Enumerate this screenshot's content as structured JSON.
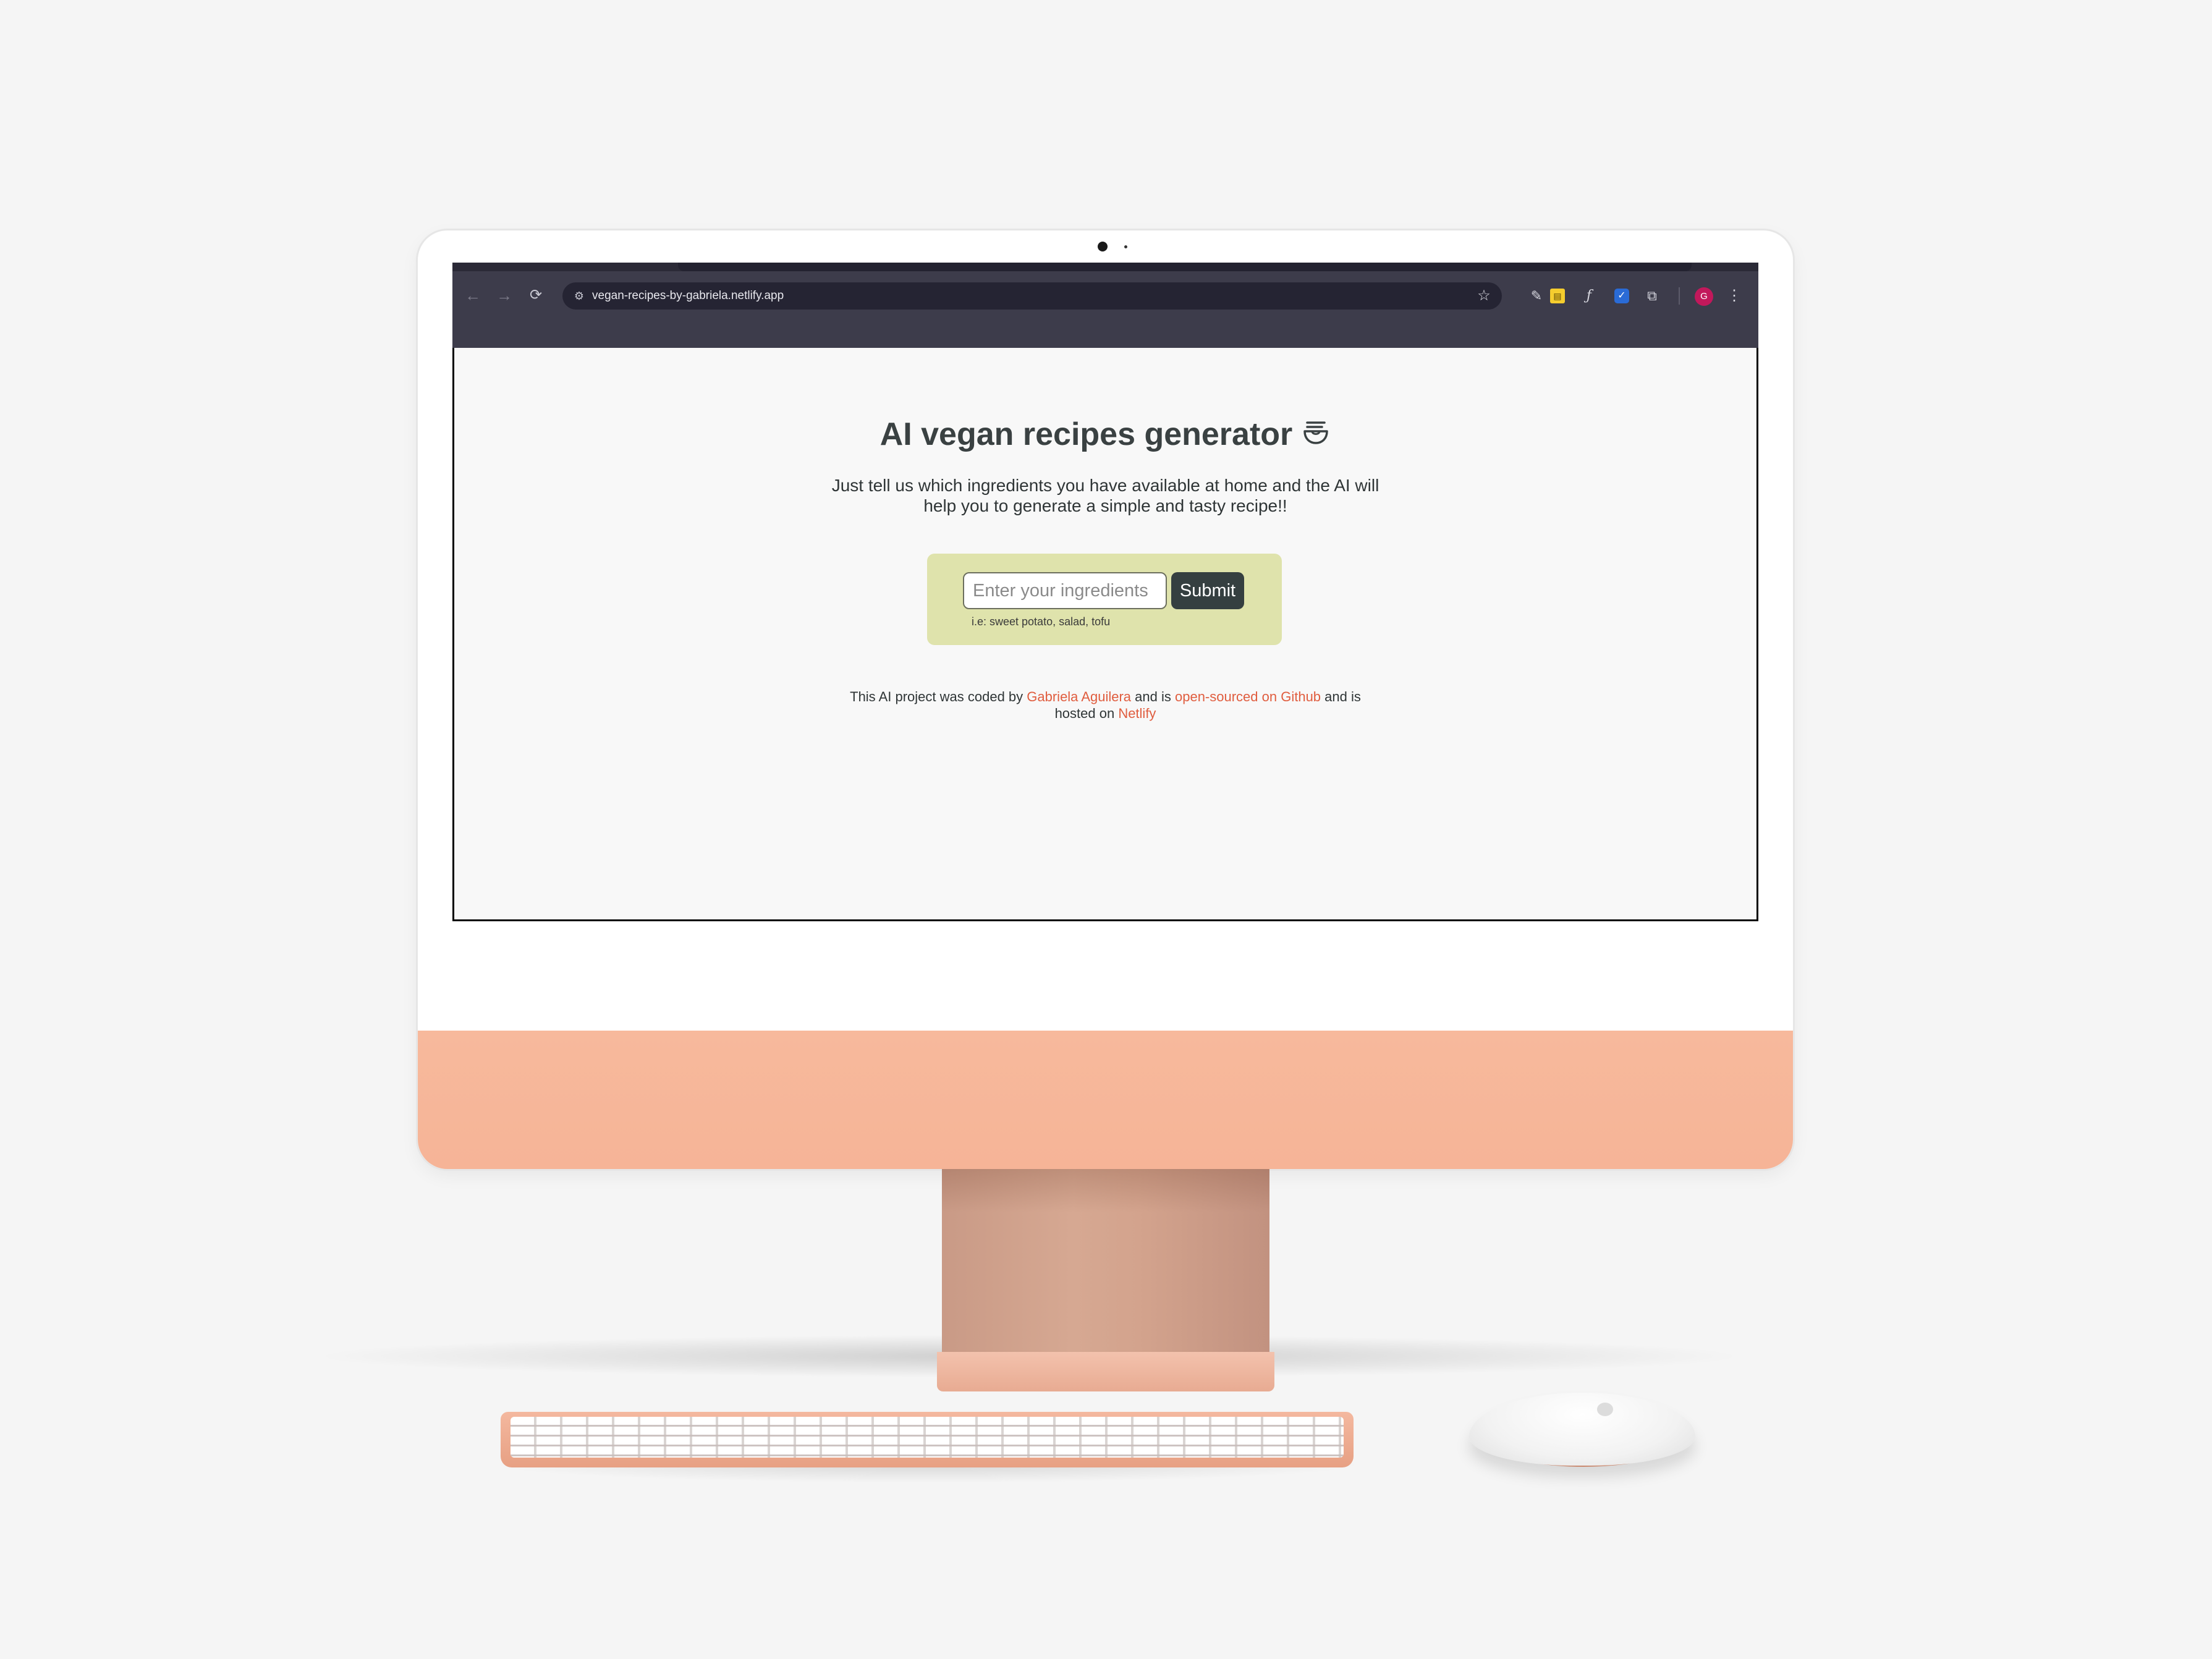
{
  "browser": {
    "url": "vegan-recipes-by-gabriela.netlify.app",
    "avatar_letter": "G",
    "icons": {
      "back": "arrow-left-icon",
      "forward": "arrow-right-icon",
      "reload": "reload-icon",
      "site_settings": "tune-icon",
      "bookmark": "star-icon",
      "extensions": [
        "eyedropper-icon",
        "sticky-note-icon",
        "function-icon",
        "checkmark-icon",
        "puzzle-icon"
      ],
      "menu": "kebab-menu-icon"
    }
  },
  "page": {
    "title": "AI vegan recipes generator",
    "title_icon": "bowl-icon",
    "subtitle": "Just tell us which ingredients you have available at home and the AI will help you to generate a simple and tasty recipe!!",
    "form": {
      "placeholder": "Enter your ingredients",
      "submit_label": "Submit",
      "hint": "i.e: sweet potato, salad, tofu",
      "background": "#dfe3ac"
    },
    "footer": {
      "text_1": "This AI project was coded by ",
      "author": "Gabriela Aguilera",
      "text_2": " and is ",
      "source": "open-sourced on Github",
      "text_3": " and is hosted on ",
      "host": "Netlify"
    },
    "colors": {
      "accent_link": "#e05d3f",
      "title": "#3a4142",
      "button": "#353f40"
    }
  },
  "device": {
    "chin_color": "#f6b497"
  }
}
